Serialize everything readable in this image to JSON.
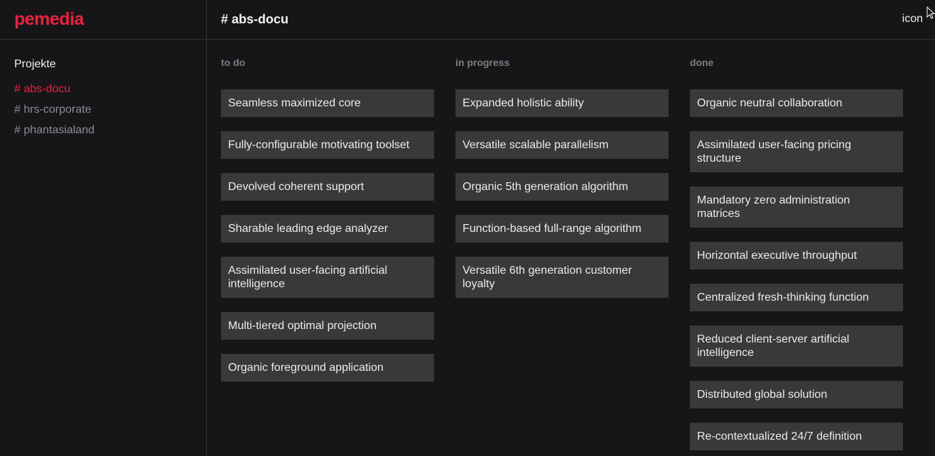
{
  "brand": {
    "logo": "pemedia",
    "accent": "#e8233f"
  },
  "sidebar": {
    "heading": "Projekte",
    "items": [
      {
        "label": "# abs-docu",
        "active": true
      },
      {
        "label": "# hrs-corporate",
        "active": false
      },
      {
        "label": "# phantasialand",
        "active": false
      }
    ]
  },
  "header": {
    "title": "# abs-docu",
    "icon_text": "icon"
  },
  "columns": [
    {
      "title": "to do",
      "cards": [
        "Seamless maximized core",
        "Fully-configurable motivating toolset",
        "Devolved coherent support",
        "Sharable leading edge analyzer",
        "Assimilated user-facing artificial intelligence",
        "Multi-tiered optimal projection",
        "Organic foreground application"
      ]
    },
    {
      "title": "in progress",
      "cards": [
        "Expanded holistic ability",
        "Versatile scalable parallelism",
        "Organic 5th generation algorithm",
        "Function-based full-range algorithm",
        "Versatile 6th generation customer loyalty"
      ]
    },
    {
      "title": "done",
      "cards": [
        "Organic neutral collaboration",
        "Assimilated user-facing pricing structure",
        "Mandatory zero administration matrices",
        "Horizontal executive throughput",
        "Centralized fresh-thinking function",
        "Reduced client-server artificial intelligence",
        "Distributed global solution",
        "Re-contextualized 24/7 definition"
      ]
    }
  ]
}
